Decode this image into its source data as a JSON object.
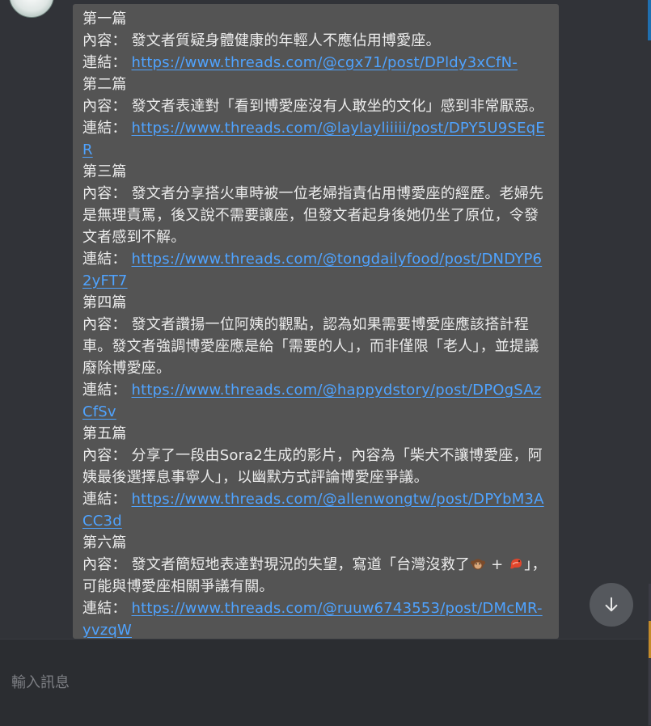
{
  "message": {
    "posts": [
      {
        "heading": "第一篇",
        "content_label": "內容：",
        "content": "發文者質疑身體健康的年輕人不應佔用博愛座。",
        "link_label": "連結：",
        "link": "https://www.threads.com/@cgx71/post/DPldy3xCfN-"
      },
      {
        "heading": "第二篇",
        "content_label": "內容：",
        "content": "發文者表達對「看到博愛座沒有人敢坐的文化」感到非常厭惡。",
        "link_label": "連結：",
        "link": "https://www.threads.com/@laylayliiiii/post/DPY5U9SEqER"
      },
      {
        "heading": "第三篇",
        "content_label": "內容：",
        "content": "發文者分享搭火車時被一位老婦指責佔用博愛座的經歷。老婦先是無理責罵，後又說不需要讓座，但發文者起身後她仍坐了原位，令發文者感到不解。",
        "link_label": "連結：",
        "link": "https://www.threads.com/@tongdailyfood/post/DNDYP62yFT7"
      },
      {
        "heading": "第四篇",
        "content_label": "內容：",
        "content": "發文者讚揚一位阿姨的觀點，認為如果需要博愛座應該搭計程車。發文者強調博愛座應是給「需要的人」，而非僅限「老人」，並提議廢除博愛座。",
        "link_label": "連結：",
        "link": "https://www.threads.com/@happydstory/post/DPOgSAzCfSv"
      },
      {
        "heading": "第五篇",
        "content_label": "內容：",
        "content": "分享了一段由Sora2生成的影片，內容為「柴犬不讓博愛座，阿姨最後選擇息事寧人」，以幽默方式評論博愛座爭議。",
        "link_label": "連結：",
        "link": "https://www.threads.com/@allenwongtw/post/DPYbM3ACC3d"
      },
      {
        "heading": "第六篇",
        "content_label": "內容：",
        "content_before": "發文者簡短地表達對現況的失望，寫道「台灣沒救了",
        "content_mid": "+",
        "content_after": "」，可能與博愛座相關爭議有關。",
        "link_label": "連結：",
        "link": "https://www.threads.com/@ruuw6743553/post/DMcMR-yvzqW"
      }
    ]
  },
  "composer": {
    "placeholder": "輸入訊息"
  },
  "icons": {
    "scroll_down": "arrow-down-icon",
    "emoji_1": "monkey-emoji-icon",
    "emoji_2": "shrimp-emoji-icon"
  },
  "colors": {
    "link": "#4fa3ff",
    "bubble": "#545454",
    "background": "#313338",
    "composer": "#2b2d31"
  }
}
